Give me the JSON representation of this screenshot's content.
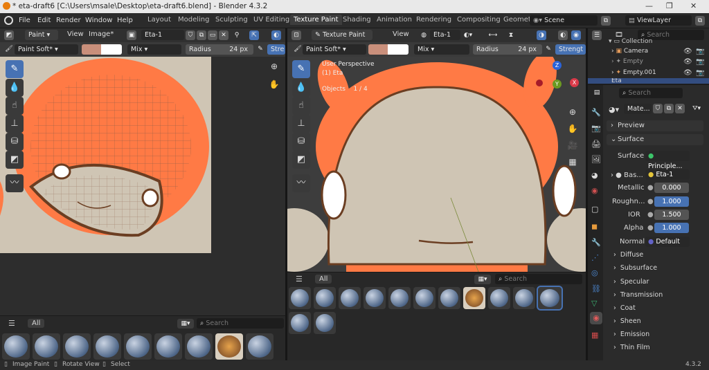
{
  "window": {
    "title": "* eta-draft6 [C:\\Users\\msale\\Desktop\\eta-draft6.blend] - Blender 4.3.2"
  },
  "menu": [
    "File",
    "Edit",
    "Render",
    "Window",
    "Help"
  ],
  "workspaces": [
    "Layout",
    "Modeling",
    "Sculpting",
    "UV Editing",
    "Texture Paint",
    "Shading",
    "Animation",
    "Rendering",
    "Compositing",
    "Geometr"
  ],
  "active_workspace": "Texture Paint",
  "scene": {
    "scene_label": "Scene",
    "viewlayer_label": "ViewLayer"
  },
  "image_editor": {
    "mode": "Paint",
    "menu": [
      "View",
      "Image*"
    ],
    "image_name": "Eta-1",
    "brush": "Paint Soft*",
    "blend": "Mix",
    "radius_label": "Radius",
    "radius_value": "24 px",
    "strength_label": "Stre",
    "brush_color": "#c98f7b"
  },
  "viewport": {
    "mode": "Texture Paint",
    "menu": "View",
    "object": "Eta-1",
    "brush": "Paint Soft*",
    "blend": "Mix",
    "radius_label": "Radius",
    "radius_value": "24 px",
    "strength_label": "Strengt",
    "overlay_lines": [
      "User Perspective",
      "(1) Eta",
      "Objects"
    ],
    "objects_count": "1 / 4",
    "gizmo": {
      "x": "X",
      "y": "Y",
      "z": "Z"
    }
  },
  "asset_shelf_left": {
    "tab": "All",
    "search_placeholder": "Search"
  },
  "asset_shelf_right": {
    "tab": "All",
    "search_placeholder": "Search"
  },
  "outliner": {
    "search_placeholder": "Search",
    "items": [
      "Collection",
      "Camera",
      "Empty",
      "Empty.001",
      "Eta"
    ]
  },
  "properties": {
    "search_placeholder": "Search",
    "material_name": "Mate...",
    "sections": {
      "preview": "Preview",
      "surface": "Surface"
    },
    "surface_label": "Surface",
    "surface_value": "Principle...",
    "base_color_label": "Bas...",
    "base_color_value": "Eta-1",
    "rows": [
      {
        "label": "Metallic",
        "value": "0.000",
        "style": "dark"
      },
      {
        "label": "Roughn...",
        "value": "1.000",
        "style": "blue"
      },
      {
        "label": "IOR",
        "value": "1.500",
        "style": "dark"
      },
      {
        "label": "Alpha",
        "value": "1.000",
        "style": "blue"
      },
      {
        "label": "Normal",
        "value": "Default",
        "style": "text"
      }
    ],
    "subpanels": [
      "Diffuse",
      "Subsurface",
      "Specular",
      "Transmission",
      "Coat",
      "Sheen",
      "Emission",
      "Thin Film"
    ]
  },
  "status_bar": {
    "items": [
      "Image Paint",
      "Rotate View",
      "Select"
    ],
    "version": "4.3.2"
  },
  "colors": {
    "accent": "#4772b3",
    "orange": "#ff7a45",
    "skin": "#cfc5b4",
    "outline": "#6b3e22"
  }
}
